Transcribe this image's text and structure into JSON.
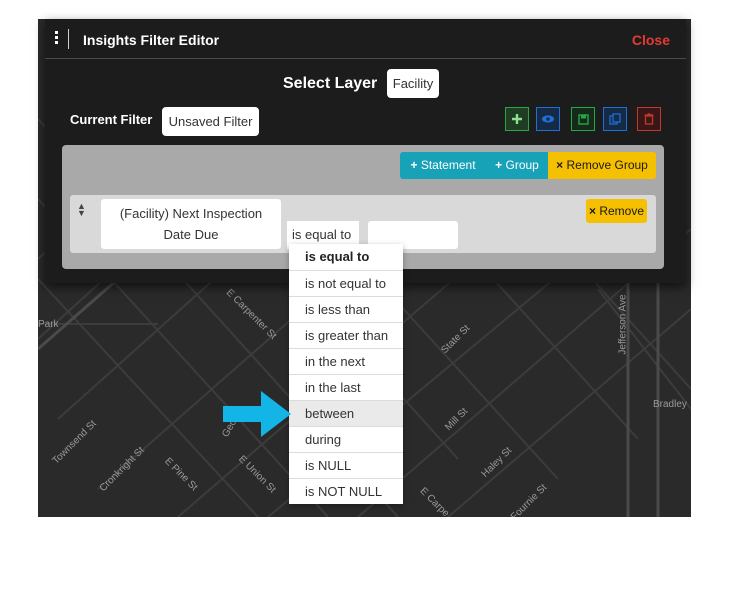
{
  "window": {
    "title": "Insights Filter Editor",
    "close_label": "Close"
  },
  "layer": {
    "label": "Select Layer",
    "value": "Facility"
  },
  "current_filter": {
    "label": "Current Filter",
    "value": "Unsaved Filter"
  },
  "toolbar": {
    "icons": [
      "plus-icon",
      "eye-icon",
      "save-icon",
      "copy-icon",
      "trash-icon"
    ]
  },
  "group": {
    "statement_label": "Statement",
    "group_label": "Group",
    "remove_group_label": "Remove Group",
    "plus_symbol": "+",
    "times_symbol": "×"
  },
  "rule": {
    "field_line1": "(Facility) Next Inspection",
    "field_line2": "Date Due",
    "operator": "is equal to",
    "value": "",
    "remove_label": "Remove",
    "sort_up": "▲",
    "sort_down": "▼"
  },
  "operators": [
    "is equal to",
    "is not equal to",
    "is less than",
    "is greater than",
    "in the next",
    "in the last",
    "between",
    "during",
    "is NULL",
    "is NOT NULL"
  ],
  "operators_selected": "is equal to",
  "operators_highlighted": "between",
  "map_labels": {
    "park": "Park",
    "carpenter_st": "E Carpenter St",
    "state_st": "State St",
    "jefferson_ave": "Jefferson Ave",
    "bradley": "Bradley",
    "mill_st": "Mill St",
    "haley_st": "Haley St",
    "fournie_st": "Fournie St",
    "townsend_st": "Townsend St",
    "cronkright_st": "Cronkright St",
    "pine_st": "E Pine St",
    "union_st": "E Union St",
    "george": "Georg",
    "e_carpe": "E Carpe"
  },
  "colors": {
    "close": "#e53935",
    "teal": "#17a2b8",
    "yellow": "#f5c000",
    "green": "#28a745",
    "blue": "#1e6fd9",
    "red": "#c0392b",
    "arrow": "#12b5e6"
  }
}
